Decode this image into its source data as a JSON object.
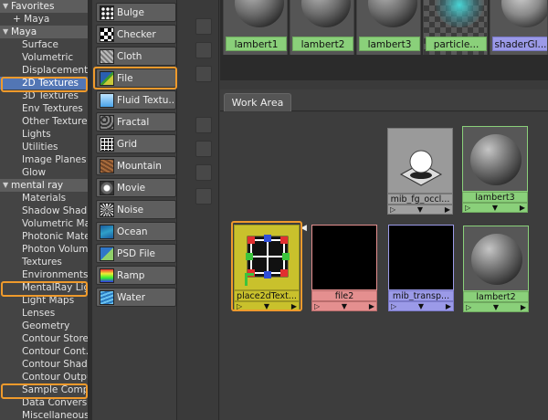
{
  "tree": {
    "favorites_header": "Favorites",
    "favorites_items": [
      "+ Maya"
    ],
    "maya_header": "Maya",
    "maya_items": [
      "Surface",
      "Volumetric",
      "Displacement",
      "2D Textures",
      "3D Textures",
      "Env Textures",
      "Other Textures",
      "Lights",
      "Utilities",
      "Image Planes",
      "Glow"
    ],
    "selected_item": "2D Textures",
    "mentalray_header": "mental ray",
    "mentalray_items": [
      "Materials",
      "Shadow Shad..",
      "Volumetric Ma..",
      "Photonic Mate",
      "Photon Volum..",
      "Textures",
      "Environments",
      "MentalRay Lig",
      "Light Maps",
      "Lenses",
      "Geometry",
      "Contour Store",
      "Contour Cont..",
      "Contour Shade",
      "Contour Outpu",
      "Sample Comp..",
      "Data Conversi",
      "Miscellaneous"
    ]
  },
  "node_types": [
    {
      "label": "Bulge",
      "icon": "bulge-icon"
    },
    {
      "label": "Checker",
      "icon": "checker-icon"
    },
    {
      "label": "Cloth",
      "icon": "cloth-icon"
    },
    {
      "label": "File",
      "icon": "file-texture-icon"
    },
    {
      "label": "Fluid Textu...",
      "icon": "fluid-texture-icon"
    },
    {
      "label": "Fractal",
      "icon": "fractal-icon"
    },
    {
      "label": "Grid",
      "icon": "grid-icon"
    },
    {
      "label": "Mountain",
      "icon": "mountain-icon"
    },
    {
      "label": "Movie",
      "icon": "movie-icon"
    },
    {
      "label": "Noise",
      "icon": "noise-icon"
    },
    {
      "label": "Ocean",
      "icon": "ocean-icon"
    },
    {
      "label": "PSD File",
      "icon": "psd-file-icon"
    },
    {
      "label": "Ramp",
      "icon": "ramp-icon"
    },
    {
      "label": "Water",
      "icon": "water-icon"
    }
  ],
  "top_swatches": [
    {
      "label": "lambert1",
      "color": "#8ad07a"
    },
    {
      "label": "lambert2",
      "color": "#8ad07a"
    },
    {
      "label": "lambert3",
      "color": "#8ad07a"
    },
    {
      "label": "particle...",
      "color": "#8ad07a"
    },
    {
      "label": "shaderGl...",
      "color": "#9b9ae8"
    }
  ],
  "tabs": {
    "work_area": "Work Area"
  },
  "nodes": {
    "mib_fg_occl": {
      "label": "mib_fg_occl...",
      "color": "#a0a0a0"
    },
    "lambert3": {
      "label": "lambert3",
      "color": "#8ad07a"
    },
    "place2d": {
      "label": "place2dText...",
      "color": "#c9c12c"
    },
    "file2": {
      "label": "file2",
      "color": "#e48f8f"
    },
    "mib_transp": {
      "label": "mib_transp...",
      "color": "#9b9ae8"
    },
    "lambert2": {
      "label": "lambert2",
      "color": "#8ad07a"
    }
  },
  "port_glyphs": {
    "left": "▷",
    "mid": "▼",
    "right": "▶"
  },
  "colors": {
    "highlight_outline": "#ef9a2c",
    "selection_blue": "#5276b5",
    "shader_green": "#8ad07a",
    "texture_red": "#e48f8f",
    "utility_purple": "#9b9ae8",
    "place2d_yellow": "#c9c12c"
  }
}
